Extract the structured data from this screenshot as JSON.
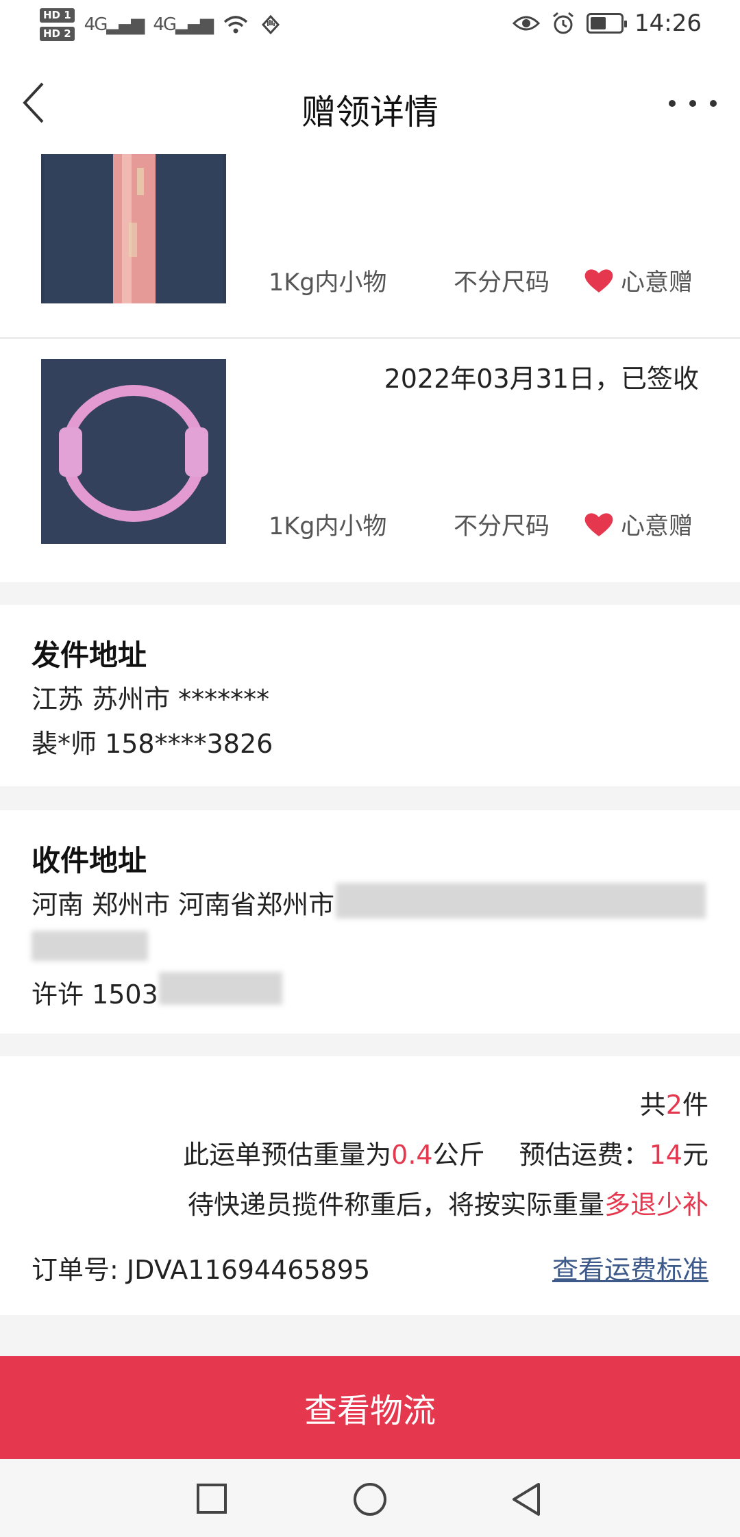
{
  "status_bar": {
    "hd1": "HD 1",
    "hd2": "HD 2",
    "net1": "4G",
    "net2": "4G",
    "time": "14:26"
  },
  "header": {
    "title": "赠领详情"
  },
  "items": [
    {
      "weight_tag": "1Kg内小物",
      "size_tag": "不分尺码",
      "gift_tag": "心意赠"
    },
    {
      "status_date": "2022年03月31日，已签收",
      "weight_tag": "1Kg内小物",
      "size_tag": "不分尺码",
      "gift_tag": "心意赠"
    }
  ],
  "sender": {
    "title": "发件地址",
    "address": "江苏 苏州市 *******",
    "contact": "裴*师 158****3826"
  },
  "receiver": {
    "title": "收件地址",
    "address_visible": "河南 郑州市 河南省郑州市",
    "contact_visible": "许许 1503"
  },
  "summary": {
    "count_prefix": "共",
    "count": "2",
    "count_suffix": "件",
    "weight_prefix": "此运单预估重量为",
    "weight_value": "0.4",
    "weight_unit": "公斤",
    "fee_prefix": "预估运费：",
    "fee_value": "14",
    "fee_unit": "元",
    "note_prefix": "待快递员揽件称重后，将按实际重量",
    "note_highlight": "多退少补",
    "order_label": "订单号:",
    "order_number": "JDVA11694465895",
    "fee_standard_link": "查看运费标准"
  },
  "cta": {
    "label": "查看物流"
  },
  "colors": {
    "accent": "#e5384f",
    "link": "#3d5a8a"
  }
}
